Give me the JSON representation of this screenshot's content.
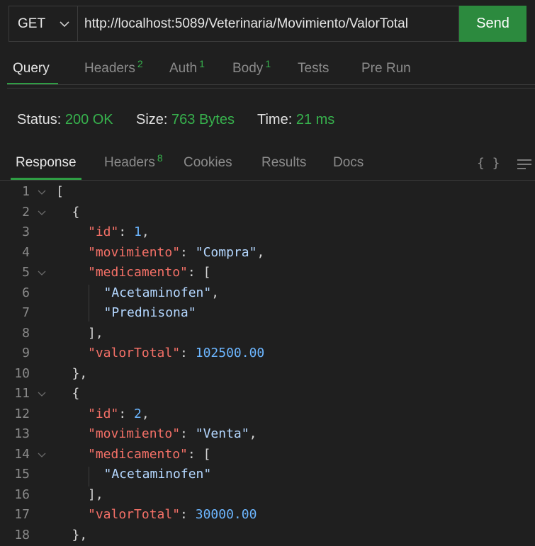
{
  "request": {
    "method": "GET",
    "url": "http://localhost:5089/Veterinaria/Movimiento/ValorTotal",
    "send_label": "Send"
  },
  "request_tabs": [
    {
      "label": "Query",
      "badge": ""
    },
    {
      "label": "Headers",
      "badge": "2"
    },
    {
      "label": "Auth",
      "badge": "1"
    },
    {
      "label": "Body",
      "badge": "1"
    },
    {
      "label": "Tests",
      "badge": ""
    },
    {
      "label": "Pre Run",
      "badge": ""
    }
  ],
  "status": {
    "status_label": "Status:",
    "status_value": "200 OK",
    "size_label": "Size:",
    "size_value": "763 Bytes",
    "time_label": "Time:",
    "time_value": "21 ms"
  },
  "response_tabs": [
    {
      "label": "Response",
      "badge": ""
    },
    {
      "label": "Headers",
      "badge": "8"
    },
    {
      "label": "Cookies",
      "badge": ""
    },
    {
      "label": "Results",
      "badge": ""
    },
    {
      "label": "Docs",
      "badge": ""
    }
  ],
  "toolbar": {
    "format_label": "{ }",
    "menu_icon": "hamburger-menu-icon"
  },
  "colors": {
    "accent": "#2c8a3e",
    "status_green": "#37b24d",
    "key": "#f47067",
    "string": "#b4d7ff",
    "number": "#6cb6ff"
  },
  "code_lines": [
    {
      "n": "1",
      "fold": true,
      "indent": 0,
      "parts": [
        [
          "p",
          "["
        ]
      ]
    },
    {
      "n": "2",
      "fold": true,
      "indent": 1,
      "parts": [
        [
          "p",
          "{"
        ]
      ]
    },
    {
      "n": "3",
      "fold": false,
      "indent": 2,
      "parts": [
        [
          "k",
          "\"id\""
        ],
        [
          "p",
          ": "
        ],
        [
          "n",
          "1"
        ],
        [
          "p",
          ","
        ]
      ]
    },
    {
      "n": "4",
      "fold": false,
      "indent": 2,
      "parts": [
        [
          "k",
          "\"movimiento\""
        ],
        [
          "p",
          ": "
        ],
        [
          "s",
          "\"Compra\""
        ],
        [
          "p",
          ","
        ]
      ]
    },
    {
      "n": "5",
      "fold": true,
      "indent": 2,
      "parts": [
        [
          "k",
          "\"medicamento\""
        ],
        [
          "p",
          ": ["
        ]
      ]
    },
    {
      "n": "6",
      "fold": false,
      "indent": 3,
      "parts": [
        [
          "s",
          "\"Acetaminofen\""
        ],
        [
          "p",
          ","
        ]
      ]
    },
    {
      "n": "7",
      "fold": false,
      "indent": 3,
      "parts": [
        [
          "s",
          "\"Prednisona\""
        ]
      ]
    },
    {
      "n": "8",
      "fold": false,
      "indent": 2,
      "parts": [
        [
          "p",
          "],"
        ]
      ]
    },
    {
      "n": "9",
      "fold": false,
      "indent": 2,
      "parts": [
        [
          "k",
          "\"valorTotal\""
        ],
        [
          "p",
          ": "
        ],
        [
          "n",
          "102500.00"
        ]
      ]
    },
    {
      "n": "10",
      "fold": false,
      "indent": 1,
      "parts": [
        [
          "p",
          "},"
        ]
      ]
    },
    {
      "n": "11",
      "fold": true,
      "indent": 1,
      "parts": [
        [
          "p",
          "{"
        ]
      ]
    },
    {
      "n": "12",
      "fold": false,
      "indent": 2,
      "parts": [
        [
          "k",
          "\"id\""
        ],
        [
          "p",
          ": "
        ],
        [
          "n",
          "2"
        ],
        [
          "p",
          ","
        ]
      ]
    },
    {
      "n": "13",
      "fold": false,
      "indent": 2,
      "parts": [
        [
          "k",
          "\"movimiento\""
        ],
        [
          "p",
          ": "
        ],
        [
          "s",
          "\"Venta\""
        ],
        [
          "p",
          ","
        ]
      ]
    },
    {
      "n": "14",
      "fold": true,
      "indent": 2,
      "parts": [
        [
          "k",
          "\"medicamento\""
        ],
        [
          "p",
          ": ["
        ]
      ]
    },
    {
      "n": "15",
      "fold": false,
      "indent": 3,
      "parts": [
        [
          "s",
          "\"Acetaminofen\""
        ]
      ]
    },
    {
      "n": "16",
      "fold": false,
      "indent": 2,
      "parts": [
        [
          "p",
          "],"
        ]
      ]
    },
    {
      "n": "17",
      "fold": false,
      "indent": 2,
      "parts": [
        [
          "k",
          "\"valorTotal\""
        ],
        [
          "p",
          ": "
        ],
        [
          "n",
          "30000.00"
        ]
      ]
    },
    {
      "n": "18",
      "fold": false,
      "indent": 1,
      "parts": [
        [
          "p",
          "},"
        ]
      ]
    }
  ]
}
